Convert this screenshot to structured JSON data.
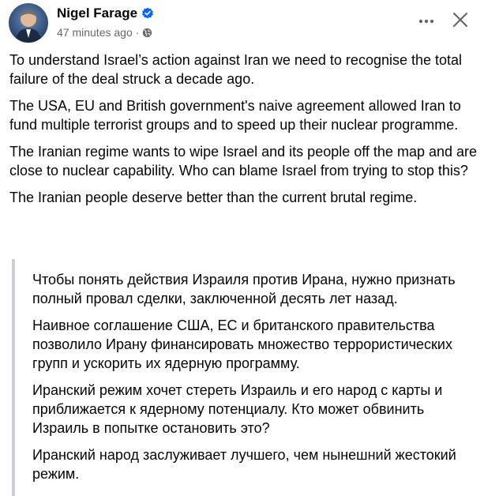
{
  "post": {
    "author": "Nigel Farage",
    "timestamp": "47 minutes ago",
    "separator": "·",
    "icons": {
      "verified": "verified-badge-icon",
      "privacy": "globe-icon",
      "more": "more-options-icon",
      "close": "close-icon"
    },
    "colors": {
      "verified": "#0866ff",
      "meta": "#65676b",
      "quote_border": "#ccd0d5"
    },
    "paragraphs": [
      "To understand Israel’s action against Iran we need to recognise the total failure of the deal struck a decade ago.",
      "The USA, EU and British government's naive agreement allowed Iran to fund multiple terrorist groups and to speed up their nuclear programme.",
      "The Iranian regime wants to wipe Israel and its people off the map and are close to nuclear capability. Who can blame Israel from trying to stop this?",
      "The Iranian people deserve better than the current brutal regime."
    ],
    "quote_paragraphs": [
      "Чтобы понять действия Израиля против Ирана, нужно признать полный провал сделки, заключенной десять лет назад.",
      "Наивное соглашение США, ЕС и британского правительства позволило Ирану финансировать множество террористических групп и ускорить их ядерную программу.",
      "Иранский режим хочет стереть Израиль и его народ с карты и приближается к ядерному потенциалу. Кто может обвинить Израиль в попытке остановить это?",
      "Иранский народ заслуживает лучшего, чем нынешний жестокий режим."
    ]
  }
}
